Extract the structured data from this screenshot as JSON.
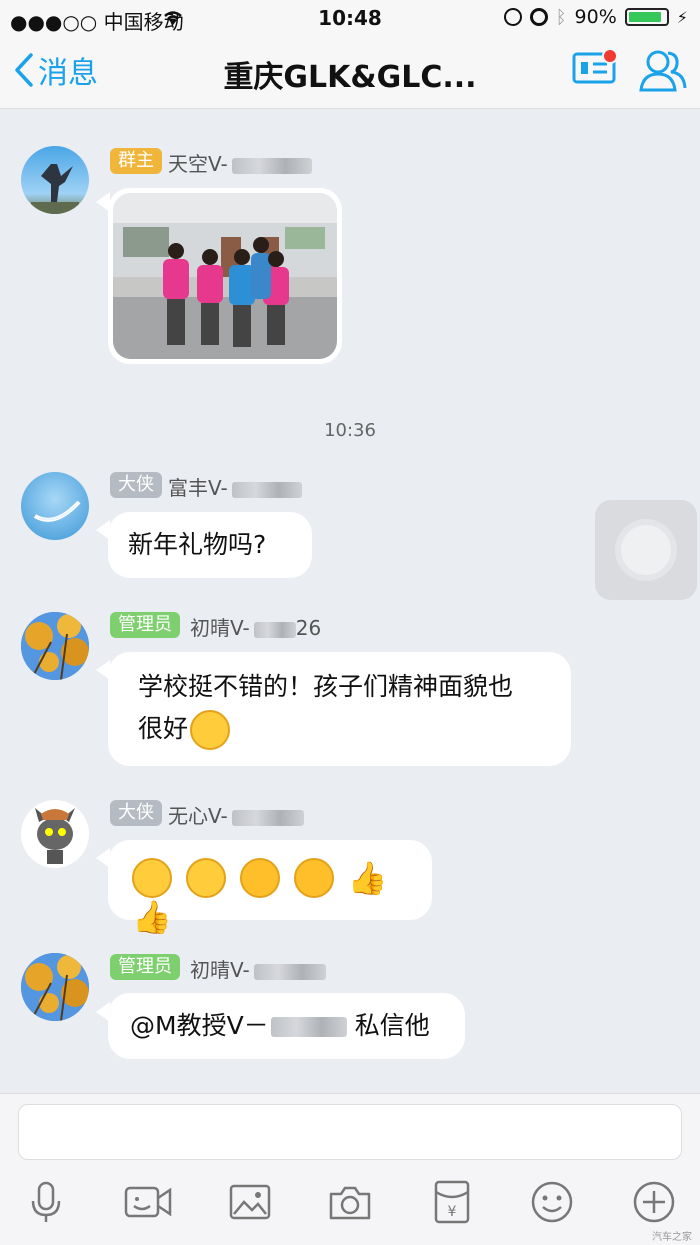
{
  "status": {
    "carrier": "●●●○○ 中国移动",
    "time": "10:48",
    "battery_pct_text": "90%",
    "battery_level": 0.9
  },
  "nav": {
    "back_label": "消息",
    "title": "重庆GLK&GLC..."
  },
  "messages": [
    {
      "badge": "群主",
      "name": "天空V-"
    },
    {
      "badge": "大侠",
      "name": "富丰V-",
      "text": "新年礼物吗?"
    },
    {
      "badge": "管理员",
      "name": "初晴V-",
      "name_suffix": "26",
      "text_line1": "学校挺不错的！孩子们精神面貌也",
      "text_line2": "很好"
    },
    {
      "badge": "大侠",
      "name": "无心V-"
    },
    {
      "badge": "管理员",
      "name": "初晴V-",
      "text_prefix": "@M教授V－",
      "text_suffix": "私信他"
    }
  ],
  "timestamp": "10:36",
  "toolbar": [
    "mic-icon",
    "video-icon",
    "image-icon",
    "camera-icon",
    "red-packet-icon",
    "emoji-icon",
    "plus-icon"
  ],
  "colors": {
    "accent": "#1aa3ea",
    "owner_badge": "#f0b63b",
    "admin_badge": "#7ed06f",
    "hero_badge": "#b6bac2",
    "unread_dot": "#ef3b32"
  },
  "watermark": "汽车之家"
}
